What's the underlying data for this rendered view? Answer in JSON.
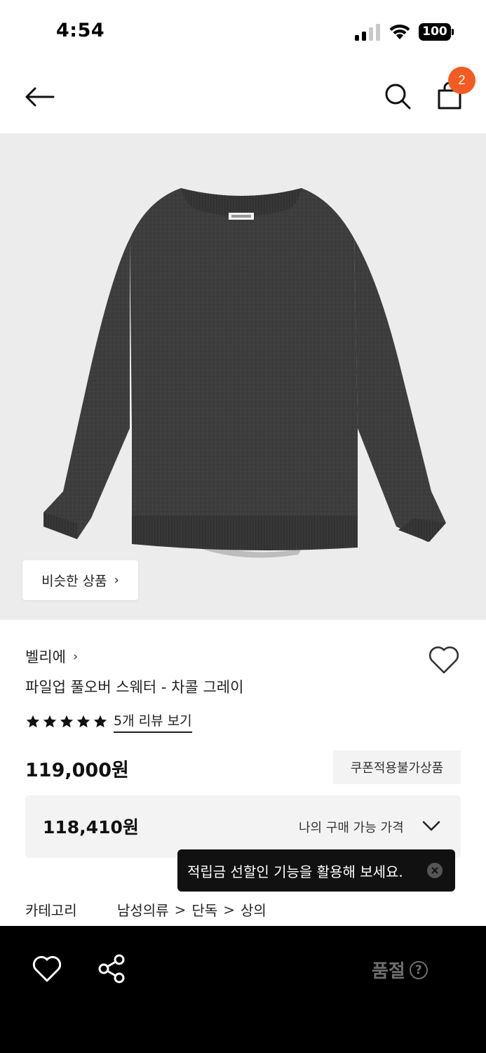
{
  "status_bar": {
    "time": "4:54",
    "battery": "100"
  },
  "nav": {
    "back_icon": "arrow-left-icon",
    "search_icon": "search-icon",
    "cart_icon": "shopping-bag-icon",
    "cart_count": "2",
    "badge_color": "#f35b22"
  },
  "image": {
    "similar_button_label": "비슷한 상품",
    "similar_button_chevron": "›"
  },
  "product": {
    "brand": "벨리에",
    "brand_chevron": "›",
    "name": "파일업 풀오버 스웨터 - 차콜 그레이",
    "rating": 5,
    "review_link": "5개 리뷰 보기",
    "price": "119,000원",
    "coupon_badge": "쿠폰적용불가상품",
    "my_price": "118,410원",
    "my_price_label": "나의 구매 가능 가격"
  },
  "tooltip": {
    "text": "적립금 선할인 기능을 활용해 보세요.",
    "close_icon": "close-icon"
  },
  "category": {
    "label": "카테고리",
    "path": [
      "남성의류",
      "단독",
      "상의"
    ]
  },
  "bottom_bar": {
    "wish_icon": "heart-icon",
    "share_icon": "share-icon",
    "soldout_label": "품절",
    "help_icon": "?"
  }
}
